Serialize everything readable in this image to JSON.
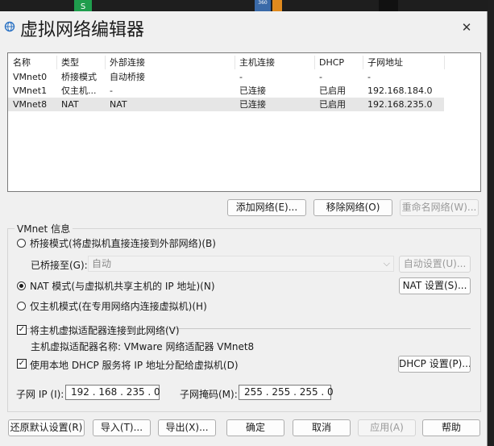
{
  "window": {
    "title": "虚拟网络编辑器"
  },
  "network_list": {
    "columns": [
      "名称",
      "类型",
      "外部连接",
      "主机连接",
      "DHCP",
      "子网地址"
    ],
    "rows": [
      {
        "name": "VMnet0",
        "type": "桥接模式",
        "external": "自动桥接",
        "host": "-",
        "dhcp": "-",
        "subnet": "-",
        "selected": false
      },
      {
        "name": "VMnet1",
        "type": "仅主机...",
        "external": "-",
        "host": "已连接",
        "dhcp": "已启用",
        "subnet": "192.168.184.0",
        "selected": false
      },
      {
        "name": "VMnet8",
        "type": "NAT",
        "external": "NAT",
        "host": "已连接",
        "dhcp": "已启用",
        "subnet": "192.168.235.0",
        "selected": true
      }
    ]
  },
  "list_buttons": {
    "add": "添加网络(E)...",
    "remove": "移除网络(O)",
    "rename": "重命名网络(W)..."
  },
  "vmnet_info": {
    "label": "VMnet 信息",
    "bridged": {
      "label": "桥接模式(将虚拟机直接连接到外部网络)(B)",
      "selected": false
    },
    "bridged_to": {
      "label": "已桥接至(G):",
      "value": "自动",
      "auto_button": "自动设置(U)..."
    },
    "nat": {
      "label": "NAT 模式(与虚拟机共享主机的 IP 地址)(N)",
      "selected": true,
      "settings_button": "NAT 设置(S)..."
    },
    "host_only": {
      "label": "仅主机模式(在专用网络内连接虚拟机)(H)",
      "selected": false
    },
    "connect_adapter": {
      "label": "将主机虚拟适配器连接到此网络(V)",
      "checked": true
    },
    "adapter_name": {
      "label": "主机虚拟适配器名称:",
      "value": "VMware 网络适配器 VMnet8"
    },
    "dhcp": {
      "label": "使用本地 DHCP 服务将 IP 地址分配给虚拟机(D)",
      "checked": true,
      "settings_button": "DHCP 设置(P)..."
    },
    "subnet_ip": {
      "label": "子网 IP (I):",
      "value": "192 . 168 . 235 .  0"
    },
    "subnet_mask": {
      "label": "子网掩码(M):",
      "value": "255 . 255 . 255 .  0"
    }
  },
  "footer_buttons": {
    "restore": "还原默认设置(R)",
    "import": "导入(T)...",
    "export": "导出(X)...",
    "ok": "确定",
    "cancel": "取消",
    "apply": "应用(A)",
    "help": "帮助"
  },
  "taskbar": {
    "green_icon": "S",
    "icon_360": "360"
  },
  "colors": {
    "selected_row": "#e6e6e6",
    "window_bg": "#f0f0f0",
    "disabled_text": "#9a9a9a"
  }
}
